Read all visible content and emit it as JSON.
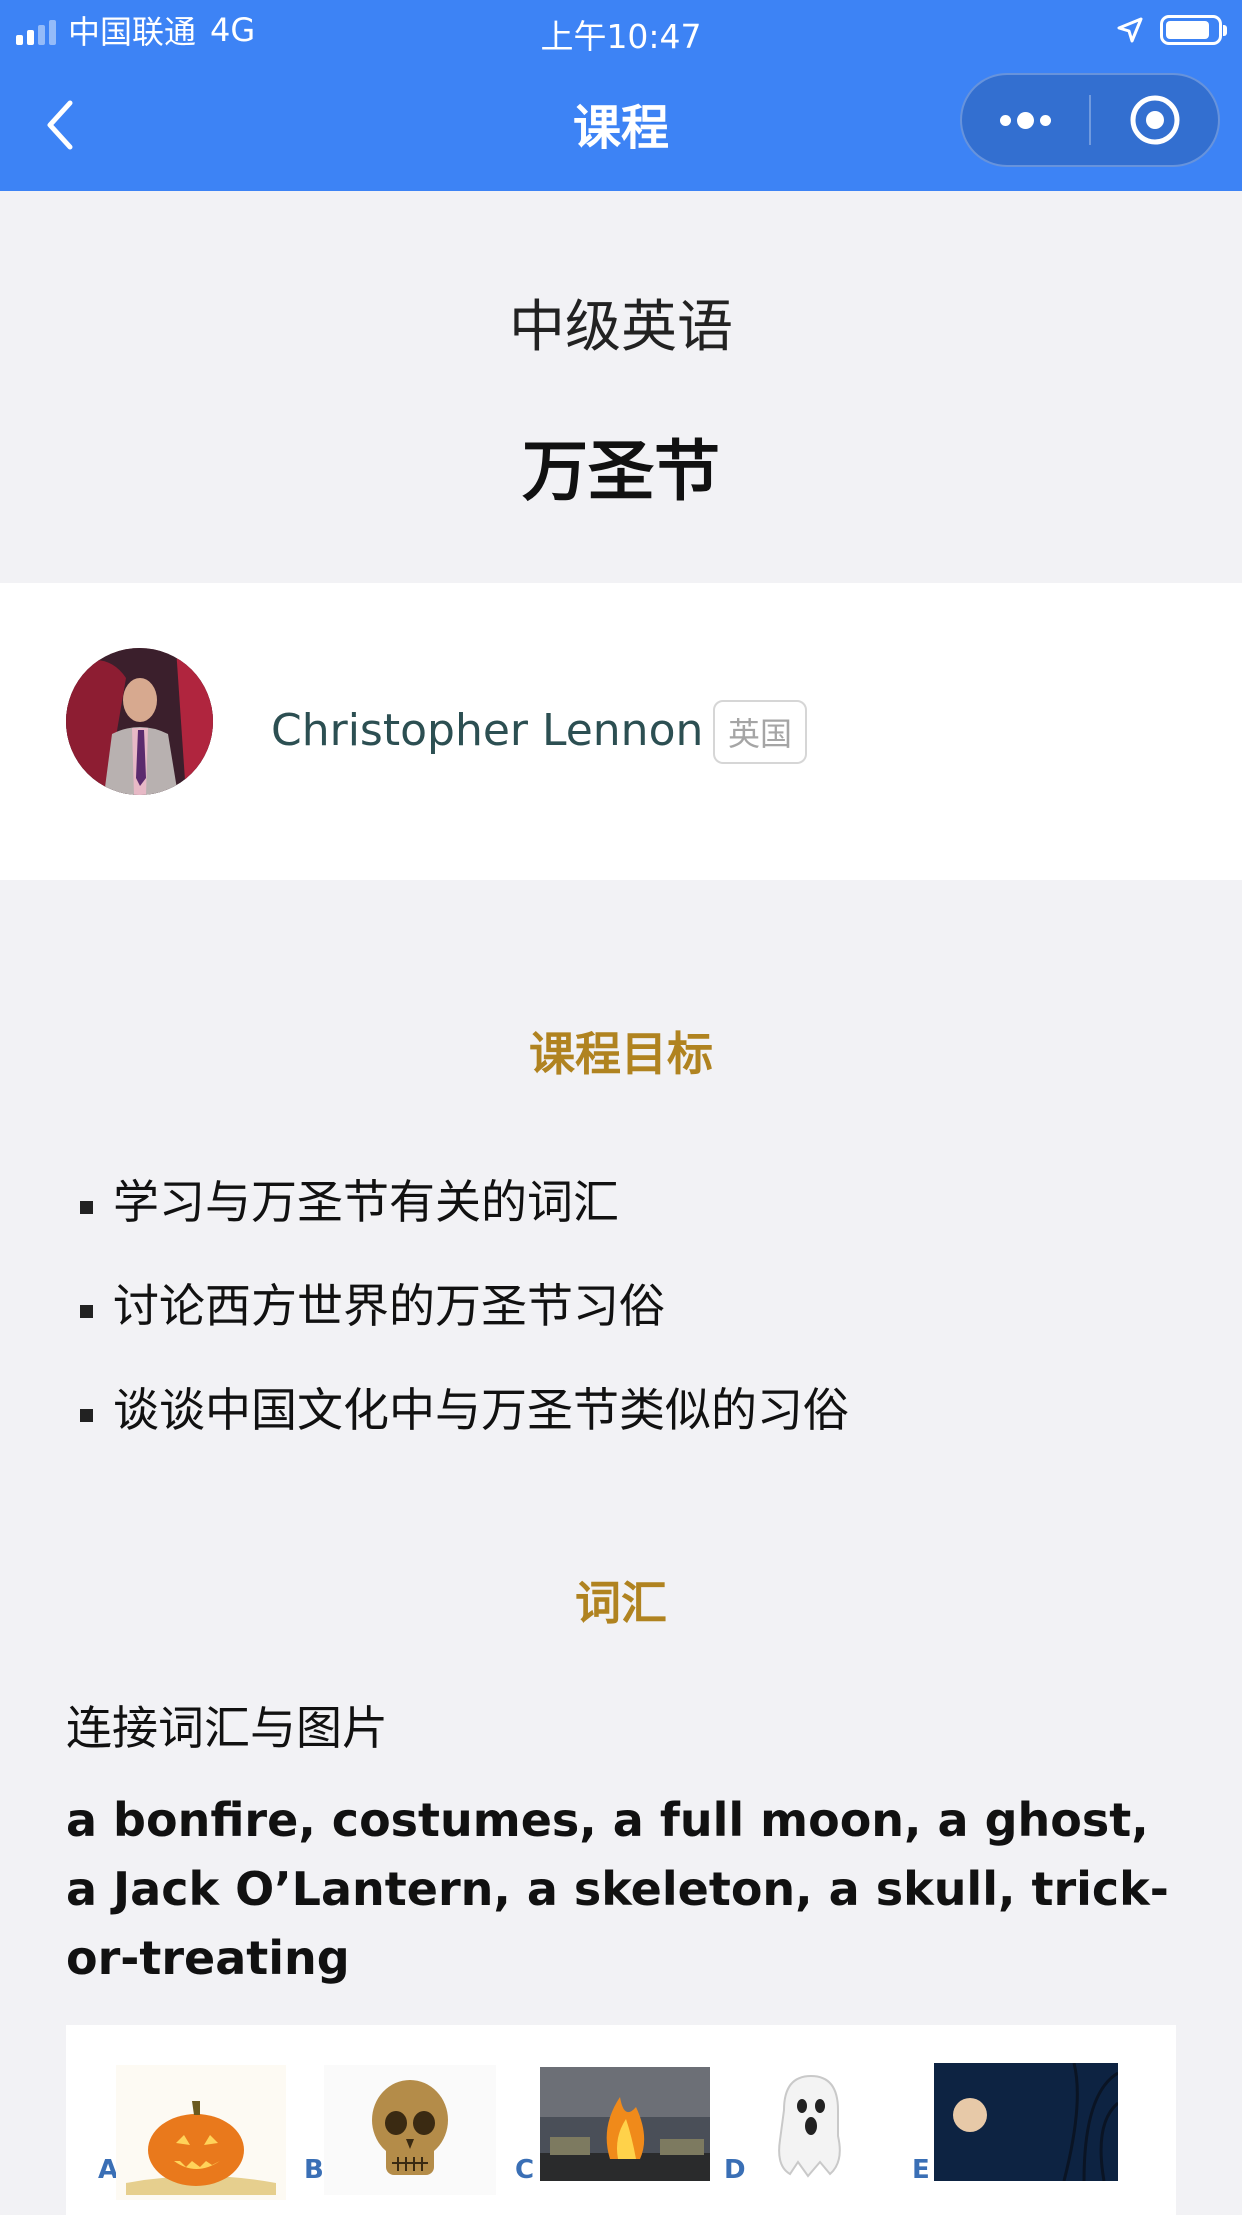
{
  "status_bar": {
    "carrier": "中国联通",
    "network": "4G",
    "time": "上午10:47",
    "battery_level": 0.85,
    "signal_bars": 2
  },
  "nav": {
    "title": "课程",
    "back_icon": "chevron-left-icon",
    "more_icon": "more-dots-icon",
    "close_icon": "target-circle-icon"
  },
  "course": {
    "level": "中级英语",
    "title": "万圣节"
  },
  "teacher": {
    "name": "Christopher Lennon",
    "country": "英国"
  },
  "goals": {
    "heading": "课程目标",
    "items": [
      "学习与万圣节有关的词汇",
      "讨论西方世界的万圣节习俗",
      "谈谈中国文化中与万圣节类似的习俗"
    ]
  },
  "vocab": {
    "heading": "词汇",
    "instruction": "连接词汇与图片",
    "words": " a bonfire, costumes, a full moon, a ghost, a Jack O’Lantern, a skeleton, a skull, trick-or-treating",
    "images": [
      {
        "label": "A",
        "icon": "pumpkin-icon"
      },
      {
        "label": "B",
        "icon": "skull-icon"
      },
      {
        "label": "C",
        "icon": "bonfire-icon"
      },
      {
        "label": "D",
        "icon": "ghost-icon"
      },
      {
        "label": "E",
        "icon": "full-moon-icon"
      }
    ]
  },
  "colors": {
    "nav_bg": "#3d83f5",
    "accent_heading": "#b08320",
    "teacher_name": "#2c4f52",
    "page_bg": "#f2f2f5"
  }
}
